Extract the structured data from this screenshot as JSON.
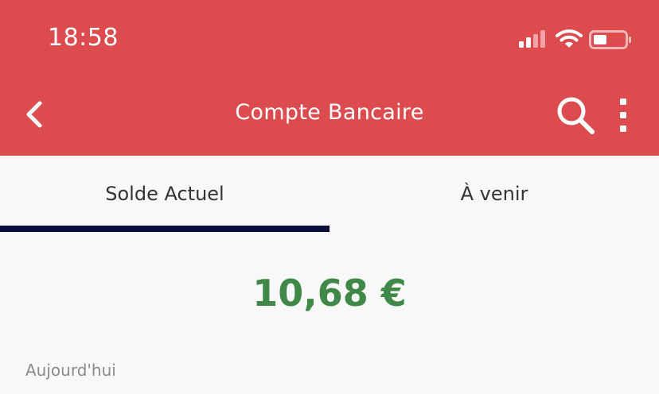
{
  "status_bar": {
    "time": "18:58"
  },
  "header": {
    "title": "Compte Bancaire",
    "back_icon": "chevron-left-icon",
    "search_icon": "search-icon",
    "more_icon": "more-vertical-icon",
    "background_color": "#dc4b4e"
  },
  "tabs": [
    {
      "label": "Solde Actuel",
      "active": true
    },
    {
      "label": "À venir",
      "active": false
    }
  ],
  "tab_indicator_color": "#0b0a3a",
  "balance": {
    "amount": "10,68 €",
    "color": "#3f8848"
  },
  "section": {
    "label": "Aujourd'hui"
  }
}
